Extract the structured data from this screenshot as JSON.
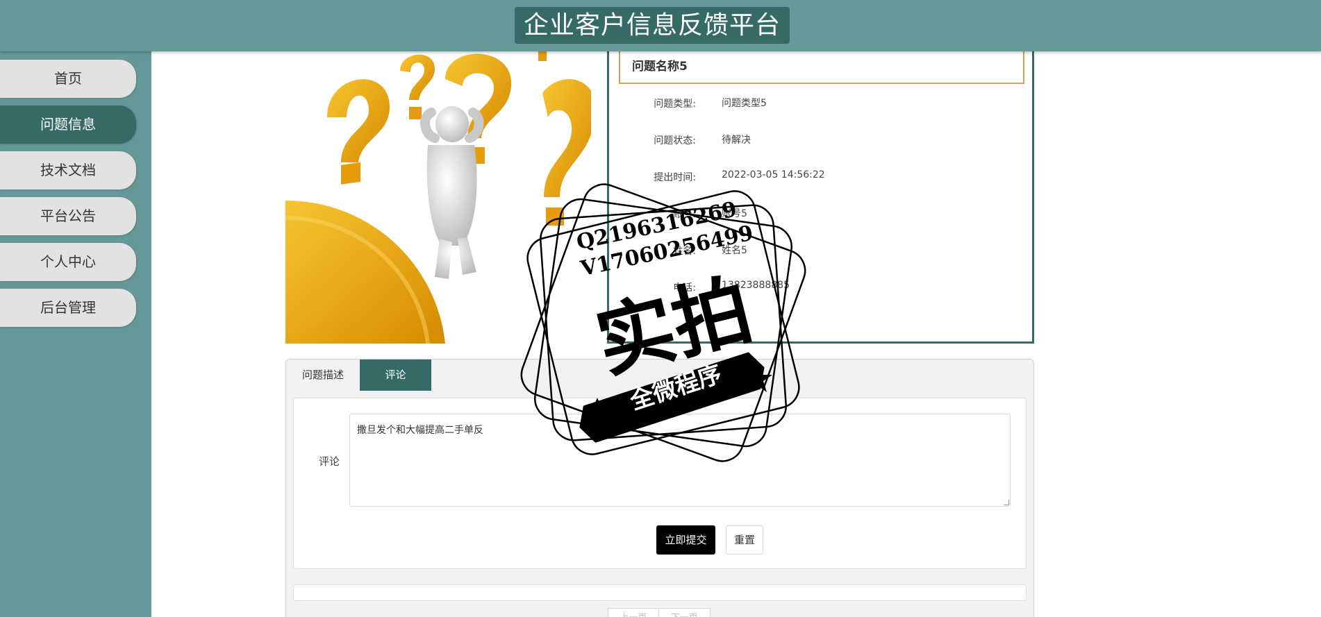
{
  "header": {
    "title": "企业客户信息反馈平台"
  },
  "sidebar": {
    "items": [
      {
        "label": "首页"
      },
      {
        "label": "问题信息"
      },
      {
        "label": "技术文档"
      },
      {
        "label": "平台公告"
      },
      {
        "label": "个人中心"
      },
      {
        "label": "后台管理"
      }
    ],
    "active_item": "问题信息"
  },
  "detail": {
    "name": "问题名称5",
    "rows": [
      {
        "label": "问题类型:",
        "value": "问题类型5"
      },
      {
        "label": "问题状态:",
        "value": "待解决"
      },
      {
        "label": "提出时间:",
        "value": "2022-03-05 14:56:22"
      },
      {
        "label": "账号:",
        "value": "账号5"
      },
      {
        "label": "姓名:",
        "value": "姓名5"
      },
      {
        "label": "电话:",
        "value": "13823888885"
      }
    ]
  },
  "tabs": [
    {
      "label": "问题描述"
    },
    {
      "label": "评论"
    }
  ],
  "active_tab": "评论",
  "comment": {
    "label": "评论",
    "value": "撒旦发个和大幅提高二手单反"
  },
  "buttons": {
    "submit": "立即提交",
    "reset": "重置"
  },
  "pager": {
    "prev": "上一页",
    "next": "下一页"
  },
  "watermark": {
    "line1": "Q2196316269",
    "line2": "V17060256499",
    "big": "实拍",
    "ribbon": "全微程序"
  },
  "colors": {
    "header": "#659898",
    "primary": "#356a66",
    "accent_border": "#c8a45a"
  }
}
